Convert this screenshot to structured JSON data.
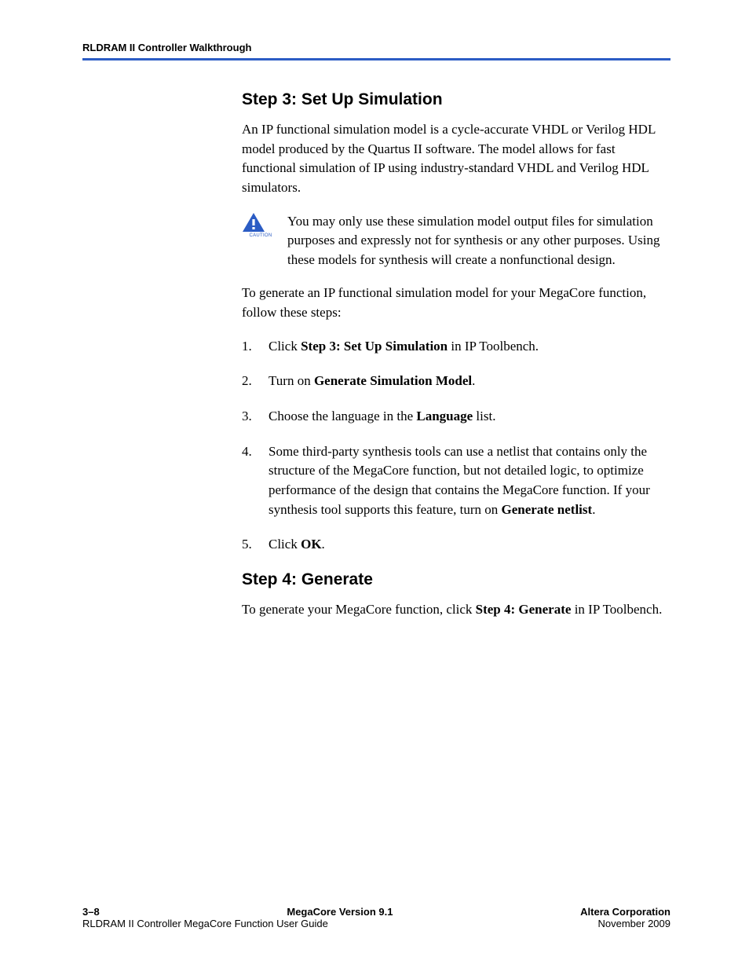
{
  "running_head": "RLDRAM II Controller Walkthrough",
  "step3": {
    "heading": "Step 3: Set Up Simulation",
    "intro": "An IP functional simulation model is a cycle-accurate VHDL or Verilog HDL model produced by the Quartus II software. The model allows for fast functional simulation of IP using industry-standard VHDL and Verilog HDL simulators.",
    "caution": "You may only use these simulation model output files for simulation purposes and expressly not for synthesis or any other purposes. Using these models for synthesis will create a nonfunctional design.",
    "lead": "To generate an IP functional simulation model for your MegaCore function, follow these steps:",
    "items": {
      "i1_pre": "Click ",
      "i1_bold": "Step 3: Set Up Simulation",
      "i1_post": " in IP Toolbench.",
      "i2_pre": "Turn on ",
      "i2_bold": "Generate Simulation Model",
      "i2_post": ".",
      "i3_pre": "Choose the language in the ",
      "i3_bold": "Language",
      "i3_post": " list.",
      "i4_pre": "Some third-party synthesis tools can use a netlist that contains only the structure of the MegaCore function, but not detailed logic, to optimize performance of the design that contains the MegaCore function. If your synthesis tool supports this feature, turn on ",
      "i4_bold": "Generate netlist",
      "i4_post": ".",
      "i5_pre": "Click ",
      "i5_bold": "OK",
      "i5_post": "."
    }
  },
  "step4": {
    "heading": "Step 4: Generate",
    "para_pre": "To generate your MegaCore function, click ",
    "para_bold": "Step 4: Generate",
    "para_post": " in IP Toolbench."
  },
  "footer": {
    "page_num": "3–8",
    "center1": "MegaCore Version 9.1",
    "right1": "Altera Corporation",
    "left2": "RLDRAM II Controller MegaCore Function User Guide",
    "right2": "November 2009"
  },
  "caution_label": "CAUTION"
}
